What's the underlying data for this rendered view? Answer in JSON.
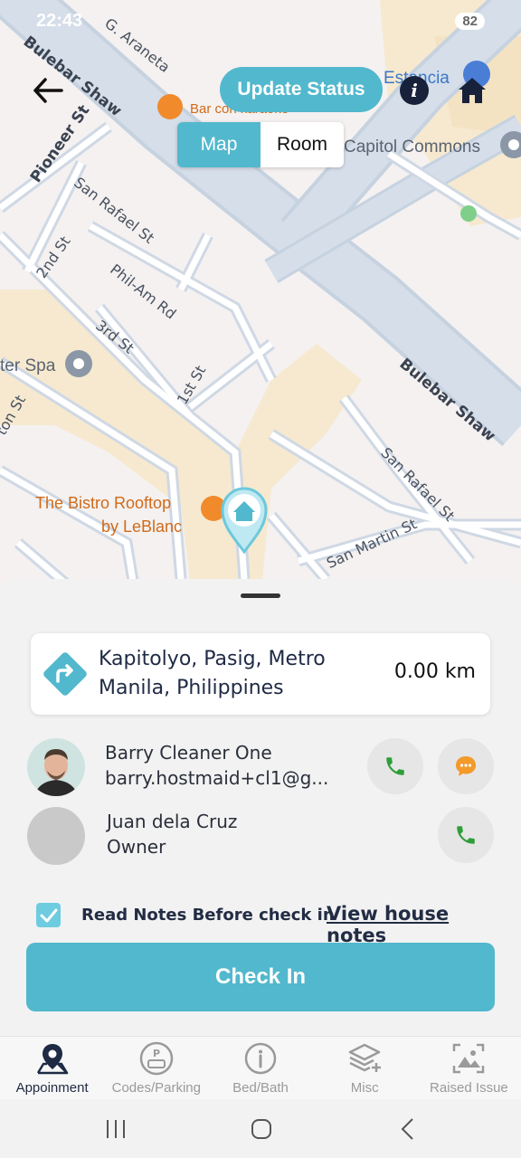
{
  "status_bar": {
    "time": "22:43",
    "battery": "82"
  },
  "map": {
    "roads": {
      "bulebar_shaw_top": "Bulebar Shaw",
      "bulebar_shaw_right": "Bulebar Shaw",
      "pioneer": "Pioneer St",
      "san_rafael_top": "San Rafael St",
      "san_rafael_bottom": "San Rafael St",
      "second": "2nd St",
      "phil_am": "Phil-Am Rd",
      "third": "3rd St",
      "first": "1st St",
      "san_martin": "San Martin St",
      "g_araneta": "G. Araneta",
      "ton_st": "ton St"
    },
    "pois": {
      "bar": "Bar con karaoke",
      "estancia": "Estancia",
      "capitol_commons": "Capitol Commons",
      "spa": "ter Spa",
      "bistro_line1": "The Bistro Rooftop",
      "bistro_line2": "by LeBlanc"
    }
  },
  "header": {
    "update_status": "Update Status",
    "info_icon": "i",
    "tabs": [
      {
        "label": "Map",
        "active": true
      },
      {
        "label": "Room",
        "active": false
      }
    ]
  },
  "address": {
    "text": "Kapitolyo, Pasig, Metro Manila, Philippines",
    "distance": "0.00 km"
  },
  "contacts": [
    {
      "name": "Barry Cleaner One",
      "sub": "barry.hostmaid+cl1@g...",
      "actions": [
        "phone-icon",
        "chat-icon"
      ]
    },
    {
      "name": "Juan dela Cruz",
      "sub": "Owner",
      "actions": [
        "phone-icon"
      ]
    }
  ],
  "notes": {
    "checked": true,
    "label": "Read Notes Before check in",
    "link": "View house notes"
  },
  "checkin_label": "Check In",
  "tabbar": [
    {
      "label": "Appoinment",
      "icon": "map-pin-icon",
      "active": true
    },
    {
      "label": "Codes/Parking",
      "icon": "parking-icon",
      "active": false
    },
    {
      "label": "Bed/Bath",
      "icon": "info-circle-icon",
      "active": false
    },
    {
      "label": "Misc",
      "icon": "layers-plus-icon",
      "active": false
    },
    {
      "label": "Raised Issue",
      "icon": "image-frame-icon",
      "active": false
    }
  ],
  "colors": {
    "accent": "#52b8cd",
    "navy": "#1f2a44",
    "phone_green": "#2f9e3a",
    "chat_orange": "#f39a2b"
  }
}
